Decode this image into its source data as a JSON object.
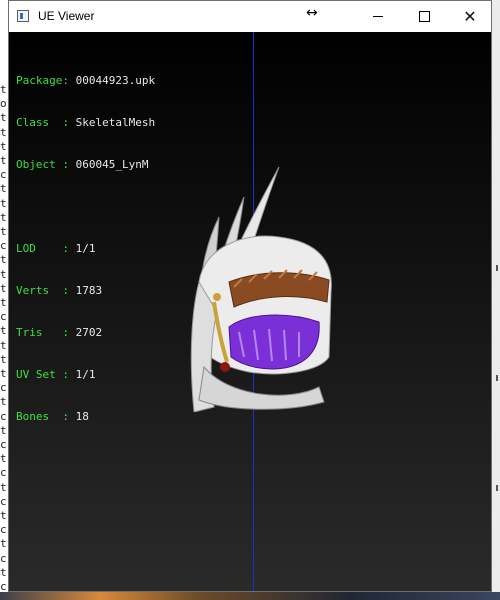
{
  "window": {
    "title": "UE Viewer",
    "resize_cursor": "↔"
  },
  "info": {
    "package": {
      "label": "Package",
      "value": "00044923.upk"
    },
    "class": {
      "label": "Class  ",
      "value": "SkeletalMesh"
    },
    "object": {
      "label": "Object ",
      "value": "060045_LynM"
    },
    "lod": {
      "label": "LOD    ",
      "value": "1/1"
    },
    "verts": {
      "label": "Verts  ",
      "value": "1783"
    },
    "tris": {
      "label": "Tris   ",
      "value": "2702"
    },
    "uvset": {
      "label": "UV Set ",
      "value": "1/1"
    },
    "bones": {
      "label": "Bones  ",
      "value": "18"
    }
  },
  "background_chars": [
    "t",
    "o",
    "t",
    "t",
    "t",
    "t",
    "c",
    "t",
    "t",
    "t",
    "t",
    "c",
    "t",
    "t",
    "t",
    "t",
    "c",
    "t",
    "t",
    "t",
    "t",
    "c",
    "t",
    "c",
    "t",
    "c",
    "t",
    "c",
    "t",
    "c",
    "t",
    "c",
    "t",
    "c",
    "t",
    "c"
  ],
  "colors": {
    "label": "#3ee03e",
    "axis": "#1b2dd6"
  },
  "model": {
    "name": "feathered-helmet-mesh"
  }
}
